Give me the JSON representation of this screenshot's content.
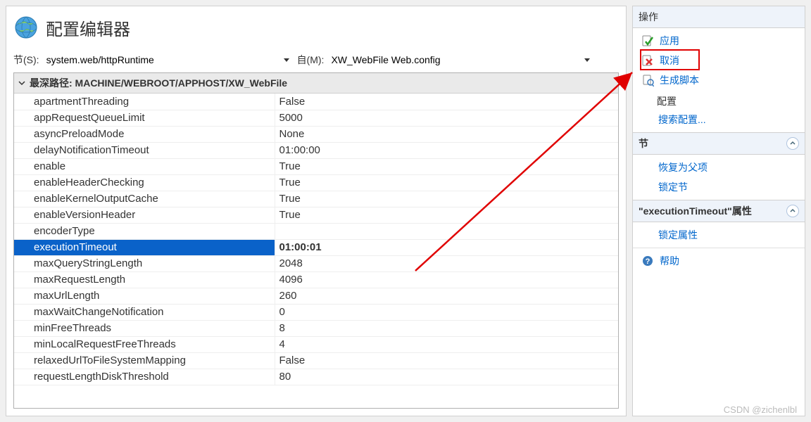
{
  "header": {
    "title": "配置编辑器"
  },
  "pathbar": {
    "section_label": "节(S):",
    "section_value": "system.web/httpRuntime",
    "from_label": "自(M):",
    "from_value": "XW_WebFile Web.config"
  },
  "group": {
    "label": "最深路径: MACHINE/WEBROOT/APPHOST/XW_WebFile"
  },
  "properties": [
    {
      "name": "apartmentThreading",
      "value": "False"
    },
    {
      "name": "appRequestQueueLimit",
      "value": "5000"
    },
    {
      "name": "asyncPreloadMode",
      "value": "None"
    },
    {
      "name": "delayNotificationTimeout",
      "value": "01:00:00"
    },
    {
      "name": "enable",
      "value": "True"
    },
    {
      "name": "enableHeaderChecking",
      "value": "True"
    },
    {
      "name": "enableKernelOutputCache",
      "value": "True"
    },
    {
      "name": "enableVersionHeader",
      "value": "True"
    },
    {
      "name": "encoderType",
      "value": ""
    },
    {
      "name": "executionTimeout",
      "value": "01:00:01",
      "selected": true
    },
    {
      "name": "maxQueryStringLength",
      "value": "2048"
    },
    {
      "name": "maxRequestLength",
      "value": "4096"
    },
    {
      "name": "maxUrlLength",
      "value": "260"
    },
    {
      "name": "maxWaitChangeNotification",
      "value": "0"
    },
    {
      "name": "minFreeThreads",
      "value": "8"
    },
    {
      "name": "minLocalRequestFreeThreads",
      "value": "4"
    },
    {
      "name": "relaxedUrlToFileSystemMapping",
      "value": "False"
    },
    {
      "name": "requestLengthDiskThreshold",
      "value": "80"
    }
  ],
  "actions": {
    "header": "操作",
    "apply": "应用",
    "cancel": "取消",
    "gen_script": "生成脚本",
    "config_heading": "配置",
    "search_config": "搜索配置...",
    "section_header": "节",
    "restore_parent": "恢复为父项",
    "lock_section": "锁定节",
    "prop_header": "\"executionTimeout\"属性",
    "lock_prop": "锁定属性",
    "help": "帮助"
  },
  "watermark": "CSDN @zichenlbl"
}
